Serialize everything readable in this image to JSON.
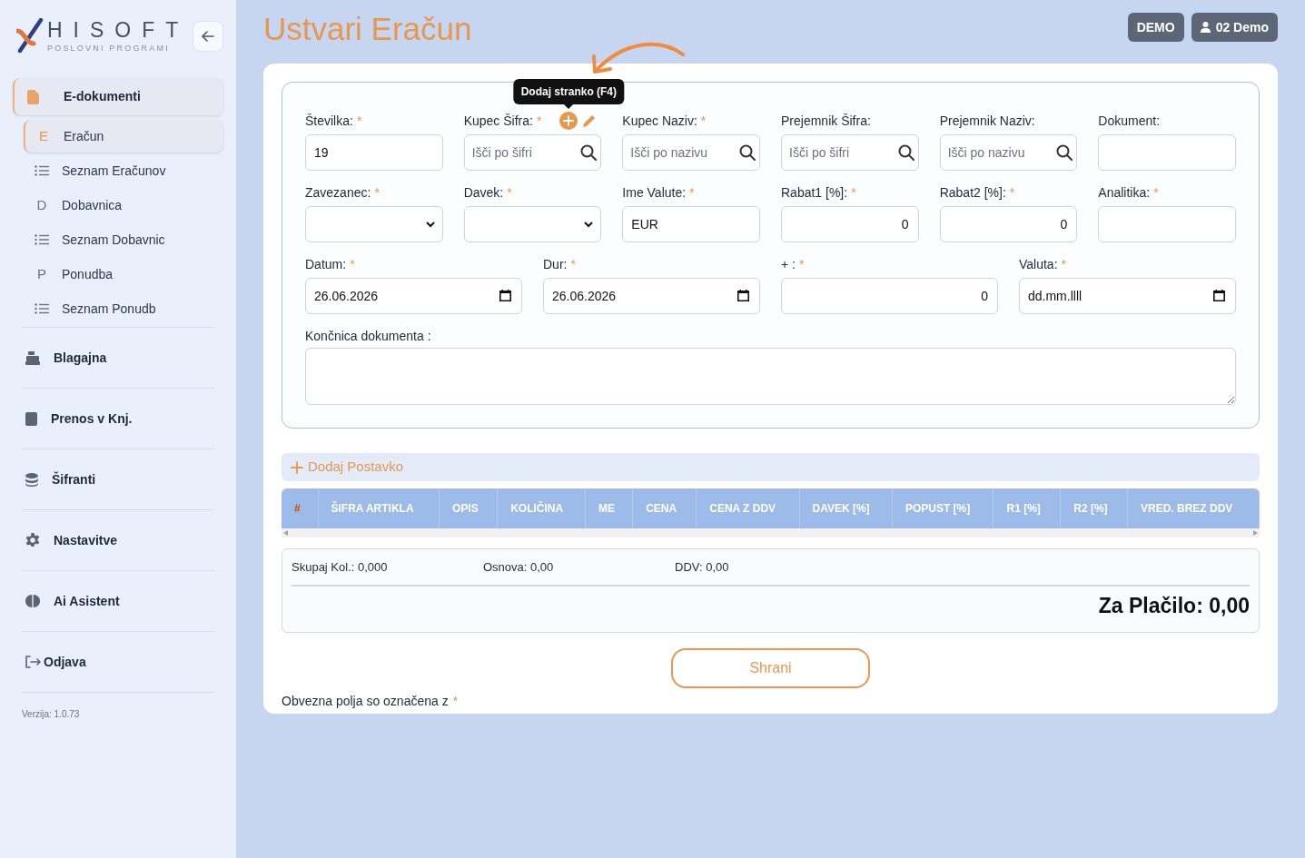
{
  "logo": {
    "title": "HISOFT",
    "subtitle": "POSLOVNI PROGRAMI"
  },
  "sidebar": {
    "items": [
      {
        "label": "E-dokumenti",
        "selected": true,
        "children": [
          {
            "kind": "letter",
            "icon": "E",
            "label": "Eračun",
            "selected": true
          },
          {
            "kind": "list",
            "label": "Seznam Eračunov",
            "selected": false
          },
          {
            "kind": "letter",
            "icon": "D",
            "label": "Dobavnica",
            "selected": false
          },
          {
            "kind": "list",
            "label": "Seznam Dobavnic",
            "selected": false
          },
          {
            "kind": "letter",
            "icon": "P",
            "label": "Ponudba",
            "selected": false
          },
          {
            "kind": "list",
            "label": "Seznam Ponudb",
            "selected": false
          }
        ]
      },
      {
        "label": "Blagajna",
        "selected": false
      },
      {
        "label": "Prenos v Knj.",
        "selected": false
      },
      {
        "label": "Šifranti",
        "selected": false
      },
      {
        "label": "Nastavitve",
        "selected": false
      },
      {
        "label": "Ai Asistent",
        "selected": false
      },
      {
        "label": "Odjava",
        "selected": false
      }
    ],
    "version": "Verzija: 1.0.73"
  },
  "header": {
    "title": "Ustvari Eračun",
    "badges": [
      {
        "kind": "text",
        "label": "DEMO"
      },
      {
        "kind": "user",
        "label": "02 Demo"
      }
    ]
  },
  "form": {
    "rows": [
      [
        {
          "label": "Številka:",
          "mark": "*",
          "kind": "text",
          "value": "19"
        },
        {
          "label": "Kupec Šifra:",
          "mark": "*",
          "kind": "search",
          "placeholder": "Išči po šifri",
          "tooltip": "Dodaj stranko (F4)"
        },
        {
          "label": "Kupec Naziv:",
          "mark": "*",
          "kind": "search",
          "placeholder": "Išči po nazivu"
        },
        {
          "label": "Prejemnik Šifra:",
          "kind": "search",
          "placeholder": "Išči po šifri"
        },
        {
          "label": "Prejemnik Naziv:",
          "kind": "search",
          "placeholder": "Išči po nazivu"
        },
        {
          "label": "Dokument:",
          "kind": "text"
        }
      ],
      [
        {
          "label": "Zavezanec:",
          "mark": "*",
          "kind": "select"
        },
        {
          "label": "Davek:",
          "mark": "*",
          "kind": "select"
        },
        {
          "label": "Ime Valute:",
          "mark": "*",
          "kind": "text",
          "value": "EUR"
        },
        {
          "label": "Rabat1 [%]:",
          "mark": "*",
          "kind": "number",
          "value": "0"
        },
        {
          "label": "Rabat2 [%]:",
          "mark": "*",
          "kind": "number",
          "value": "0"
        },
        {
          "label": "Analitika:",
          "mark": "*",
          "kind": "text"
        }
      ]
    ],
    "date_row": [
      {
        "label": "Datum:",
        "mark": "*",
        "kind": "date",
        "value": "26.06.2026"
      },
      {
        "label": "Dur:",
        "mark": "*",
        "kind": "date",
        "value": "26.06.2026"
      },
      {
        "label": "+ :",
        "mark": "*",
        "kind": "number",
        "value": "0"
      },
      {
        "label": "Valuta:",
        "mark": "*",
        "kind": "date",
        "value": "dd.mm.llll"
      }
    ],
    "suffix_field": {
      "label": "Končnica dokumenta :",
      "kind": "textarea"
    }
  },
  "add_item": {
    "label": "Dodaj Postavko"
  },
  "table": {
    "columns": [
      "#",
      "ŠIFRA ARTIKLA",
      "OPIS",
      "KOLIČINA",
      "ME",
      "CENA",
      "CENA Z DDV",
      "DAVEK [%]",
      "POPUST [%]",
      "R1 [%]",
      "R2 [%]",
      "VRED. BREZ DDV"
    ]
  },
  "totals": {
    "items": [
      "Skupaj Kol.: 0,000",
      "Osnova: 0,00",
      "DDV: 0,00"
    ],
    "total": "Za Plačilo: 0,00"
  },
  "save_button": "Shrani",
  "note": {
    "text": "Obvezna polja so označena z",
    "mark": "*"
  }
}
